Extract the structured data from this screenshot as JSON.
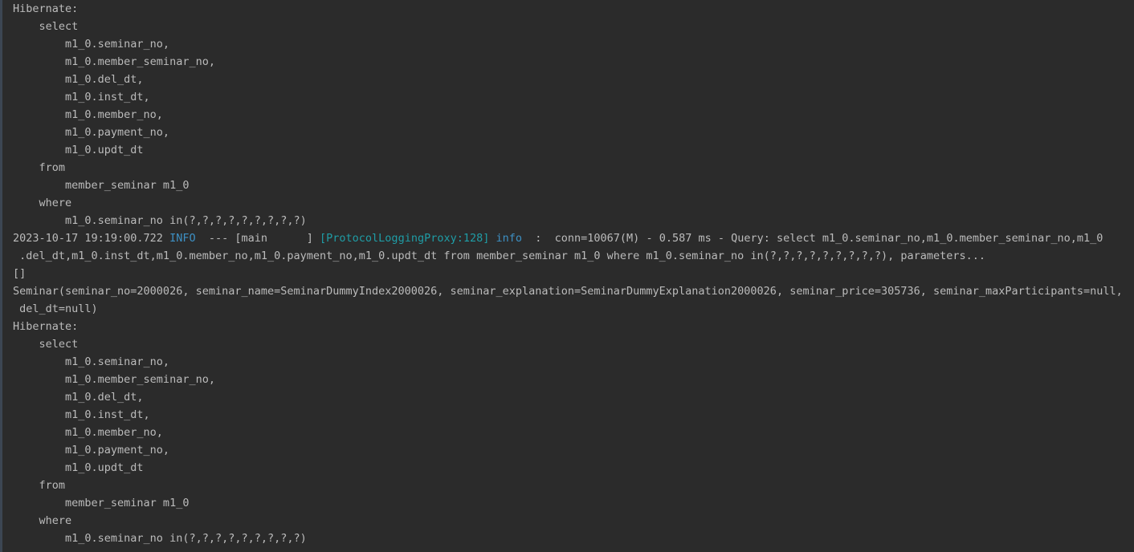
{
  "console": {
    "lines": [
      [
        {
          "t": "Hibernate: ",
          "c": "plain"
        }
      ],
      [
        {
          "t": "    select",
          "c": "plain"
        }
      ],
      [
        {
          "t": "        m1_0.seminar_no,",
          "c": "plain"
        }
      ],
      [
        {
          "t": "        m1_0.member_seminar_no,",
          "c": "plain"
        }
      ],
      [
        {
          "t": "        m1_0.del_dt,",
          "c": "plain"
        }
      ],
      [
        {
          "t": "        m1_0.inst_dt,",
          "c": "plain"
        }
      ],
      [
        {
          "t": "        m1_0.member_no,",
          "c": "plain"
        }
      ],
      [
        {
          "t": "        m1_0.payment_no,",
          "c": "plain"
        }
      ],
      [
        {
          "t": "        m1_0.updt_dt ",
          "c": "plain"
        }
      ],
      [
        {
          "t": "    from",
          "c": "plain"
        }
      ],
      [
        {
          "t": "        member_seminar m1_0 ",
          "c": "plain"
        }
      ],
      [
        {
          "t": "    where",
          "c": "plain"
        }
      ],
      [
        {
          "t": "        m1_0.seminar_no in(?,?,?,?,?,?,?,?,?)",
          "c": "plain"
        }
      ],
      [
        {
          "t": "2023-10-17 19:19:00.722 ",
          "c": "plain"
        },
        {
          "t": "INFO",
          "c": "info"
        },
        {
          "t": "  --- [main      ] ",
          "c": "plain"
        },
        {
          "t": "[ProtocolLoggingProxy:128]",
          "c": "logger"
        },
        {
          "t": " ",
          "c": "plain"
        },
        {
          "t": "info",
          "c": "level"
        },
        {
          "t": "  :  conn=10067(M) - 0.587 ms - Query: select m1_0.seminar_no,m1_0.member_seminar_no,m1_0",
          "c": "plain"
        }
      ],
      [
        {
          "t": " .del_dt,m1_0.inst_dt,m1_0.member_no,m1_0.payment_no,m1_0.updt_dt from member_seminar m1_0 where m1_0.seminar_no in(?,?,?,?,?,?,?,?,?), parameters...",
          "c": "plain"
        }
      ],
      [
        {
          "t": "[]",
          "c": "plain"
        }
      ],
      [
        {
          "t": "Seminar(seminar_no=2000026, seminar_name=SeminarDummyIndex2000026, seminar_explanation=SeminarDummyExplanation2000026, seminar_price=305736, seminar_maxParticipants=null,",
          "c": "plain"
        }
      ],
      [
        {
          "t": " del_dt=null)",
          "c": "plain"
        }
      ],
      [
        {
          "t": "Hibernate: ",
          "c": "plain"
        }
      ],
      [
        {
          "t": "    select",
          "c": "plain"
        }
      ],
      [
        {
          "t": "        m1_0.seminar_no,",
          "c": "plain"
        }
      ],
      [
        {
          "t": "        m1_0.member_seminar_no,",
          "c": "plain"
        }
      ],
      [
        {
          "t": "        m1_0.del_dt,",
          "c": "plain"
        }
      ],
      [
        {
          "t": "        m1_0.inst_dt,",
          "c": "plain"
        }
      ],
      [
        {
          "t": "        m1_0.member_no,",
          "c": "plain"
        }
      ],
      [
        {
          "t": "        m1_0.payment_no,",
          "c": "plain"
        }
      ],
      [
        {
          "t": "        m1_0.updt_dt ",
          "c": "plain"
        }
      ],
      [
        {
          "t": "    from",
          "c": "plain"
        }
      ],
      [
        {
          "t": "        member_seminar m1_0 ",
          "c": "plain"
        }
      ],
      [
        {
          "t": "    where",
          "c": "plain"
        }
      ],
      [
        {
          "t": "        m1_0.seminar_no in(?,?,?,?,?,?,?,?,?)",
          "c": "plain"
        }
      ]
    ]
  }
}
